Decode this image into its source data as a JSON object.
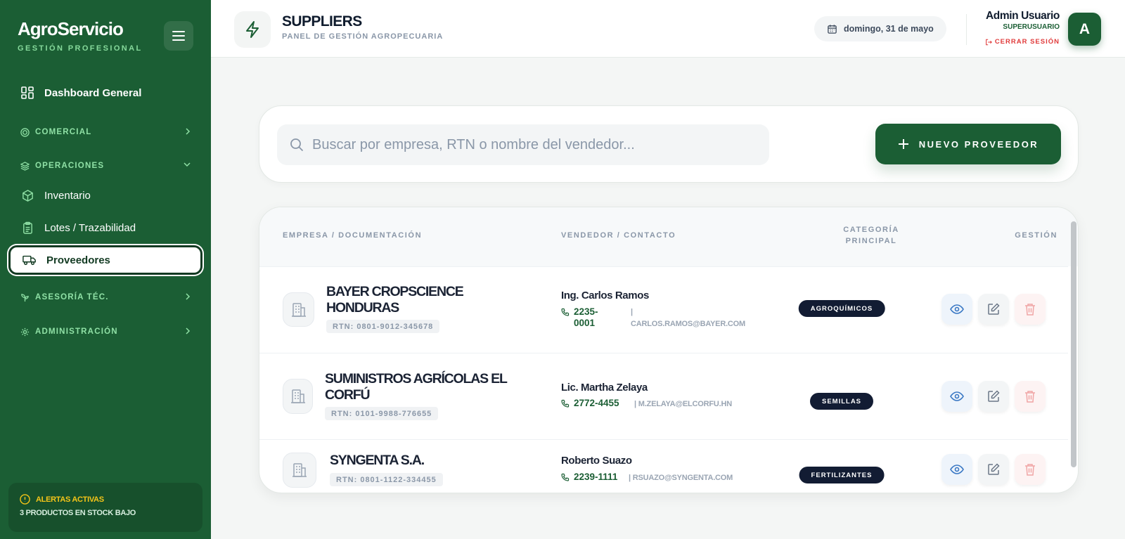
{
  "brand": {
    "title": "AgroServicio",
    "subtitle": "GESTIÓN PROFESIONAL"
  },
  "sidebar": {
    "dashboard": "Dashboard General",
    "sections": {
      "comercial": "COMERCIAL",
      "operaciones": "OPERACIONES",
      "asesoria": "ASESORÍA TÉC.",
      "administracion": "ADMINISTRACIÓN"
    },
    "items": {
      "inventario": "Inventario",
      "lotes": "Lotes / Trazabilidad",
      "proveedores": "Proveedores"
    },
    "alert": {
      "title": "ALERTAS ACTIVAS",
      "message": "3 PRODUCTOS EN STOCK BAJO"
    }
  },
  "header": {
    "title": "SUPPLIERS",
    "subtitle": "PANEL DE GESTIÓN AGROPECUARIA",
    "date": "domingo, 31 de mayo",
    "user_name": "Admin Usuario",
    "user_role": "SUPERUSUARIO",
    "logout": "CERRAR SESIÓN",
    "avatar": "A"
  },
  "search": {
    "placeholder": "Buscar por empresa, RTN o nombre del vendedor...",
    "value": ""
  },
  "new_button": "NUEVO PROVEEDOR",
  "table": {
    "headers": {
      "empresa": "EMPRESA / DOCUMENTACIÓN",
      "vendedor": "VENDEDOR / CONTACTO",
      "categoria_1": "CATEGORÍA",
      "categoria_2": "PRINCIPAL",
      "gestion": "GESTIÓN"
    },
    "rows": [
      {
        "company_1": "BAYER CROPSCIENCE",
        "company_2": "HONDURAS",
        "rtn": "RTN: 0801-9012-345678",
        "vendor": "Ing. Carlos Ramos",
        "phone_1": "2235-",
        "phone_2": "0001",
        "email_sep": "|",
        "email": "CARLOS.RAMOS@BAYER.COM",
        "category": "AGROQUÍMICOS"
      },
      {
        "company_1": "SUMINISTROS AGRÍCOLAS EL",
        "company_2": "CORFÚ",
        "rtn": "RTN: 0101-9988-776655",
        "vendor": "Lic. Martha Zelaya",
        "phone": "2772-4455",
        "email": "| M.ZELAYA@ELCORFU.HN",
        "category": "SEMILLAS"
      },
      {
        "company_1": "SYNGENTA S.A.",
        "rtn": "RTN: 0801-1122-334455",
        "vendor": "Roberto Suazo",
        "phone": "2239-1111",
        "email": "| RSUAZO@SYNGENTA.COM",
        "category": "FERTILIZANTES"
      }
    ]
  },
  "colors": {
    "brand_green": "#1b5e34",
    "badge_navy": "#121c33",
    "alert_yellow": "#f5c518",
    "logout_red": "#e03b3b"
  },
  "icons": [
    "menu-icon",
    "dashboard-icon",
    "target-icon",
    "layers-icon",
    "box-icon",
    "clipboard-icon",
    "truck-icon",
    "sprout-icon",
    "gear-icon",
    "chevron-right-icon",
    "chevron-down-icon",
    "alert-circle-icon",
    "zap-icon",
    "calendar-icon",
    "logout-icon",
    "search-icon",
    "plus-icon",
    "building-icon",
    "phone-icon",
    "eye-icon",
    "edit-icon",
    "trash-icon"
  ]
}
